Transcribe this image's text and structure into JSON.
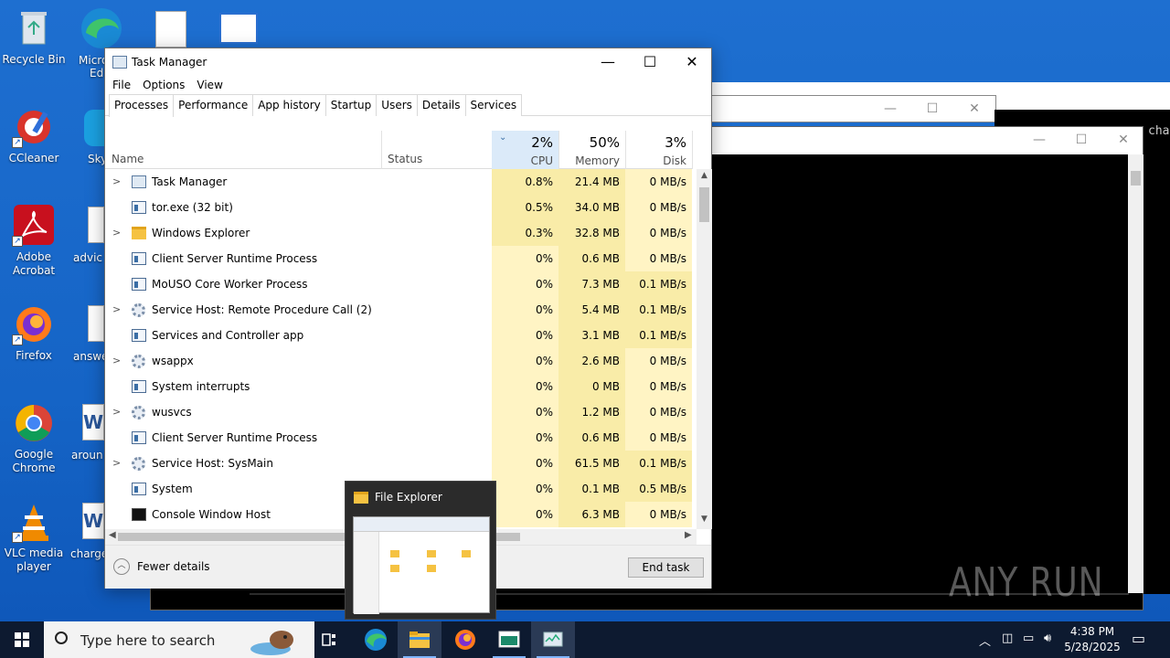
{
  "desktop": {
    "icons": [
      {
        "label": "Recycle Bin"
      },
      {
        "label": "CCleaner"
      },
      {
        "label": "Adobe Acrobat"
      },
      {
        "label": "Firefox"
      },
      {
        "label": "Google Chrome"
      },
      {
        "label": "VLC media player"
      }
    ],
    "partial_labels": [
      "Micro",
      "Ed",
      "Sky",
      "advic",
      "answe",
      "aroun",
      "charge"
    ]
  },
  "background": {
    "console_partial_text": "cha"
  },
  "task_manager": {
    "title": "Task Manager",
    "menu": [
      "File",
      "Options",
      "View"
    ],
    "tabs": [
      "Processes",
      "Performance",
      "App history",
      "Startup",
      "Users",
      "Details",
      "Services"
    ],
    "active_tab": "Processes",
    "columns": {
      "name": "Name",
      "status": "Status",
      "cpu": {
        "pct": "2%",
        "label": "CPU"
      },
      "memory": {
        "pct": "50%",
        "label": "Memory"
      },
      "disk": {
        "pct": "3%",
        "label": "Disk"
      }
    },
    "processes": [
      {
        "name": "Task Manager",
        "expandable": true,
        "icon": "task-manager-icon",
        "cpu": "0.8%",
        "memory": "21.4 MB",
        "disk": "0 MB/s"
      },
      {
        "name": "tor.exe (32 bit)",
        "expandable": false,
        "icon": "app-icon",
        "cpu": "0.5%",
        "memory": "34.0 MB",
        "disk": "0 MB/s"
      },
      {
        "name": "Windows Explorer",
        "expandable": true,
        "icon": "folder-icon",
        "cpu": "0.3%",
        "memory": "32.8 MB",
        "disk": "0 MB/s"
      },
      {
        "name": "Client Server Runtime Process",
        "expandable": false,
        "icon": "app-icon",
        "cpu": "0%",
        "memory": "0.6 MB",
        "disk": "0 MB/s"
      },
      {
        "name": "MoUSO Core Worker Process",
        "expandable": false,
        "icon": "app-icon",
        "cpu": "0%",
        "memory": "7.3 MB",
        "disk": "0.1 MB/s"
      },
      {
        "name": "Service Host: Remote Procedure Call (2)",
        "expandable": true,
        "icon": "gear-icon",
        "cpu": "0%",
        "memory": "5.4 MB",
        "disk": "0.1 MB/s"
      },
      {
        "name": "Services and Controller app",
        "expandable": false,
        "icon": "app-icon",
        "cpu": "0%",
        "memory": "3.1 MB",
        "disk": "0.1 MB/s"
      },
      {
        "name": "wsappx",
        "expandable": true,
        "icon": "gear-icon",
        "cpu": "0%",
        "memory": "2.6 MB",
        "disk": "0 MB/s"
      },
      {
        "name": "System interrupts",
        "expandable": false,
        "icon": "app-icon",
        "cpu": "0%",
        "memory": "0 MB",
        "disk": "0 MB/s"
      },
      {
        "name": "wusvcs",
        "expandable": true,
        "icon": "gear-icon",
        "cpu": "0%",
        "memory": "1.2 MB",
        "disk": "0 MB/s"
      },
      {
        "name": "Client Server Runtime Process",
        "expandable": false,
        "icon": "app-icon",
        "cpu": "0%",
        "memory": "0.6 MB",
        "disk": "0 MB/s"
      },
      {
        "name": "Service Host: SysMain",
        "expandable": true,
        "icon": "gear-icon",
        "cpu": "0%",
        "memory": "61.5 MB",
        "disk": "0.1 MB/s"
      },
      {
        "name": "System",
        "expandable": false,
        "icon": "app-icon",
        "cpu": "0%",
        "memory": "0.1 MB",
        "disk": "0.5 MB/s"
      },
      {
        "name": "Console Window Host",
        "expandable": false,
        "icon": "console-icon",
        "cpu": "0%",
        "memory": "6.3 MB",
        "disk": "0 MB/s"
      }
    ],
    "fewer_details": "Fewer details",
    "end_task": "End task"
  },
  "thumbnail": {
    "title": "File Explorer"
  },
  "taskbar": {
    "search_placeholder": "Type here to search",
    "time": "4:38 PM",
    "date": "5/28/2025"
  },
  "watermark": "ANY RUN",
  "colors": {
    "desktop": "#1564c6",
    "cpu_high": "#f9eca8",
    "cpu_low": "#fff4c4",
    "cpu_header": "#dbeaf9",
    "taskbar": "#0d1a30"
  }
}
